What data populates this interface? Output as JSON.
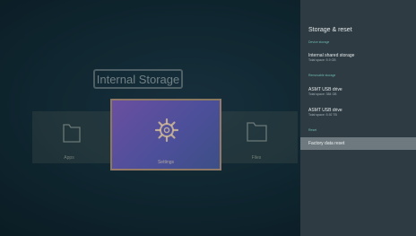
{
  "background": {
    "storage_title": "Internal Storage",
    "tiles": [
      {
        "label": "Apps",
        "icon": "folder-icon"
      },
      {
        "label": "Settings",
        "icon": "gear-icon"
      },
      {
        "label": "Files",
        "icon": "folder-icon"
      }
    ]
  },
  "panel": {
    "title": "Storage & reset",
    "sections": {
      "device_storage": "Device storage",
      "removable_storage": "Removable storage",
      "reset": "Reset"
    },
    "internal": {
      "name": "Internal shared storage",
      "space": "Total space: 5.9 GB"
    },
    "usb1": {
      "name": "ASMT USB drive",
      "space": "Total space: 384 GB"
    },
    "usb2": {
      "name": "ASMT USB drive",
      "space": "Total space: 5.92 TB"
    },
    "factory_reset": "Factory data reset"
  },
  "colors": {
    "panel_bg": "#2e3b42",
    "section_accent": "#6fb8b0",
    "selected_row": "#6d797f",
    "card_gradient_start": "#6a4fa0"
  }
}
